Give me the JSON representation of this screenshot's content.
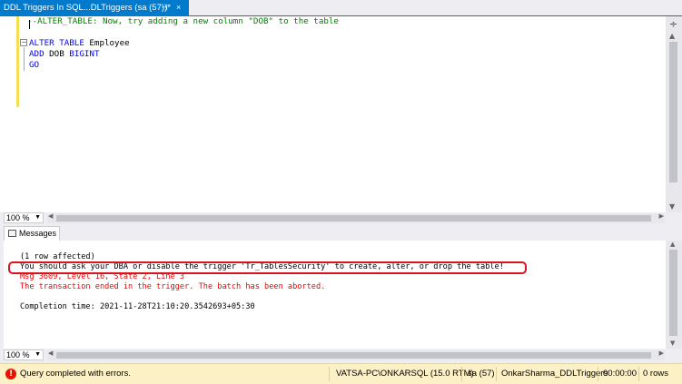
{
  "tab": {
    "title": "DDL Triggers In SQL...DLTriggers (sa (57))*",
    "pin_icon": "⊣",
    "close_icon": "×"
  },
  "editor": {
    "lines": [
      {
        "parts": [
          {
            "cls": "cmt",
            "text": "--ALTER_TABLE: Now, try adding a new column \"DOB\" to the table"
          }
        ]
      },
      {
        "parts": []
      },
      {
        "parts": [
          {
            "cls": "kw",
            "text": "ALTER TABLE"
          },
          {
            "cls": "ident",
            "text": " Employee"
          }
        ]
      },
      {
        "parts": [
          {
            "cls": "kw",
            "text": "ADD"
          },
          {
            "cls": "ident",
            "text": " DOB "
          },
          {
            "cls": "kw",
            "text": "BIGINT"
          }
        ]
      },
      {
        "parts": [
          {
            "cls": "kw",
            "text": "GO"
          }
        ]
      }
    ],
    "split_icon": "÷"
  },
  "editor_zoom": "100 %",
  "messages_tab": "Messages",
  "messages": [
    {
      "cls": "black",
      "text": "(1 row affected)"
    },
    {
      "cls": "black",
      "text": "You should ask your DBA or disable the trigger 'Tr_TablesSecurity' to create, alter, or drop the table!"
    },
    {
      "cls": "red",
      "text": "Msg 3609, Level 16, State 2, Line 3"
    },
    {
      "cls": "red",
      "text": "The transaction ended in the trigger. The batch has been aborted."
    },
    {
      "cls": "black",
      "text": ""
    },
    {
      "cls": "black",
      "text": "Completion time: 2021-11-28T21:10:20.3542693+05:30"
    }
  ],
  "messages_zoom": "100 %",
  "status": {
    "message": "Query completed with errors.",
    "server": "VATSA-PC\\ONKARSQL (15.0 RTM)",
    "user": "sa (57)",
    "database": "OnkarSharma_DDLTriggers",
    "elapsed": "00:00:00",
    "rows": "0 rows"
  },
  "colors": {
    "accent": "#007acc",
    "status_bg": "#fbf0c6",
    "error_red": "#e00000",
    "highlight": "#d8141c"
  }
}
